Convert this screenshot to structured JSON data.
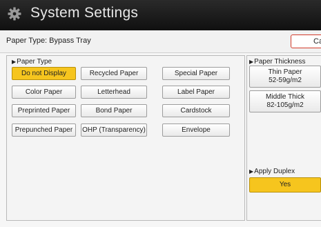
{
  "header": {
    "title": "System Settings",
    "icon": "gear-icon"
  },
  "infobar": {
    "title": "Paper Type: Bypass Tray",
    "cancel_label": "Cance"
  },
  "paper_type": {
    "label": "Paper Type",
    "options": [
      {
        "label": "Do not Display",
        "selected": true
      },
      {
        "label": "Recycled Paper",
        "selected": false
      },
      {
        "label": "Special Paper",
        "selected": false
      },
      {
        "label": "Color Paper",
        "selected": false
      },
      {
        "label": "Letterhead",
        "selected": false
      },
      {
        "label": "Label Paper",
        "selected": false
      },
      {
        "label": "Preprinted Paper",
        "selected": false
      },
      {
        "label": "Bond Paper",
        "selected": false
      },
      {
        "label": "Cardstock",
        "selected": false
      },
      {
        "label": "Prepunched Paper",
        "selected": false
      },
      {
        "label": "OHP (Transparency)",
        "selected": false
      },
      {
        "label": "Envelope",
        "selected": false
      }
    ]
  },
  "paper_thickness": {
    "label": "Paper Thickness",
    "options": [
      {
        "name": "Thin Paper",
        "range": "52-59g/m2"
      },
      {
        "name": "Middle Thick",
        "range": "82-105g/m2"
      }
    ]
  },
  "apply_duplex": {
    "label": "Apply Duplex",
    "value": "Yes"
  },
  "colors": {
    "selected": "#f6c51e",
    "cancel_border": "#d23a2a",
    "titlebar": "#1a1a1a"
  }
}
